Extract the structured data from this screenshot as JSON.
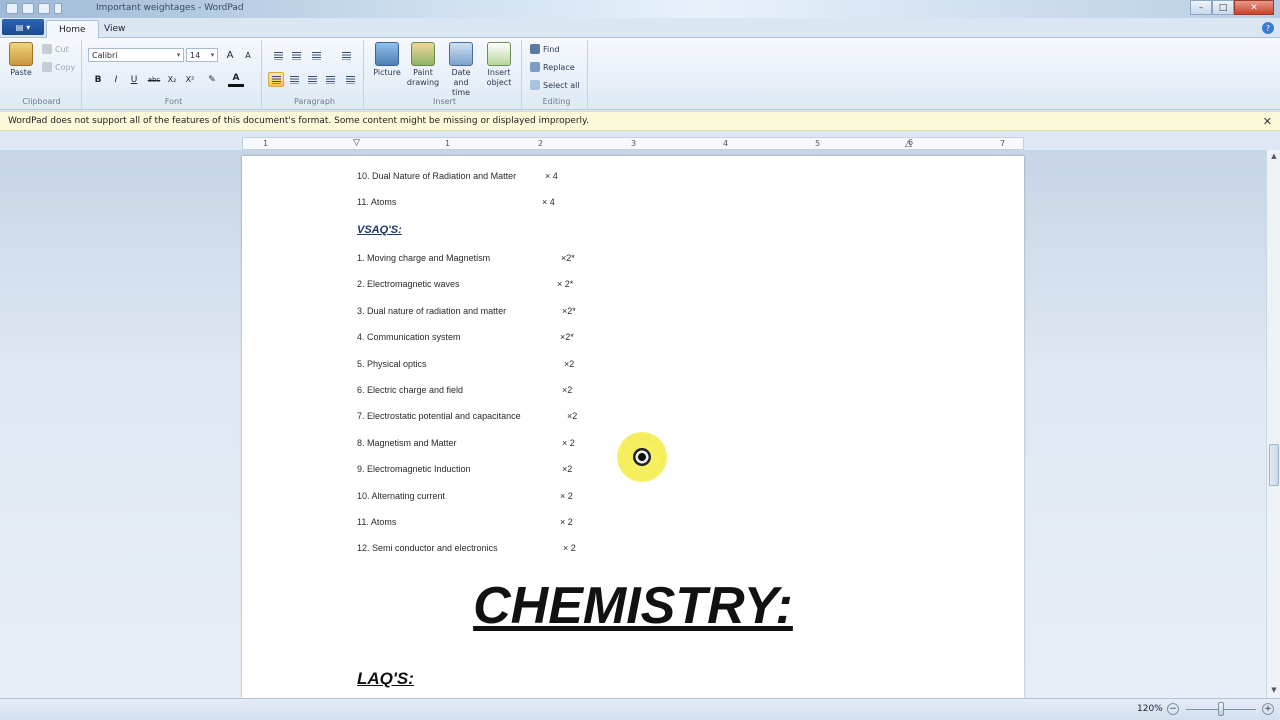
{
  "window": {
    "title": "Important weightages - WordPad",
    "minimize": "–",
    "maximize": "□",
    "close": "✕"
  },
  "tabs": {
    "home": "Home",
    "view": "View",
    "help": "?"
  },
  "ribbon": {
    "clipboard": {
      "label": "Clipboard",
      "paste": "Paste",
      "cut": "Cut",
      "copy": "Copy"
    },
    "font": {
      "label": "Font",
      "family": "Calibri",
      "size": "14",
      "bold": "B",
      "italic": "I",
      "underline": "U",
      "strike": "abc",
      "subscript": "X₂",
      "superscript": "X²",
      "grow": "A",
      "shrink": "A"
    },
    "paragraph": {
      "label": "Paragraph"
    },
    "insert": {
      "label": "Insert",
      "picture": "Picture",
      "paint": "Paint drawing",
      "datetime": "Date and time",
      "object": "Insert object"
    },
    "editing": {
      "label": "Editing",
      "find": "Find",
      "replace": "Replace",
      "select_all": "Select all"
    }
  },
  "infobar": {
    "message": "WordPad does not support all of the features of this document's format. Some content might be missing or displayed improperly.",
    "close": "✕"
  },
  "ruler": {
    "numbers": [
      "1",
      "1",
      "2",
      "3",
      "4",
      "5",
      "6",
      "7"
    ]
  },
  "document": {
    "top_lines": [
      {
        "text": "10.  Dual Nature of Radiation and Matter",
        "mark": "× 4"
      },
      {
        "text": "11.  Atoms",
        "mark": "× 4"
      }
    ],
    "vsaq_heading": "VSAQ'S:",
    "vsaq_items": [
      {
        "text": "1.  Moving charge and Magnetism",
        "mark": "×2*"
      },
      {
        "text": "2.  Electromagnetic waves",
        "mark": "× 2*"
      },
      {
        "text": "3.  Dual nature of radiation and matter",
        "mark": "×2*"
      },
      {
        "text": "4.  Communication system",
        "mark": "×2*"
      },
      {
        "text": "5.  Physical optics",
        "mark": "×2"
      },
      {
        "text": "6.  Electric charge and field",
        "mark": "×2"
      },
      {
        "text": "7.  Electrostatic potential and capacitance",
        "mark": "×2"
      },
      {
        "text": "8.  Magnetism and Matter",
        "mark": "× 2"
      },
      {
        "text": "9.  Electromagnetic Induction",
        "mark": "×2"
      },
      {
        "text": "10. Alternating current",
        "mark": "× 2"
      },
      {
        "text": "11.  Atoms",
        "mark": "× 2"
      },
      {
        "text": "12.  Semi conductor and electronics",
        "mark": "× 2"
      }
    ],
    "chemistry_heading": "CHEMISTRY:",
    "laq_heading": "LAQ'S:"
  },
  "statusbar": {
    "zoom": "120%",
    "zoom_out": "−",
    "zoom_in": "+"
  }
}
